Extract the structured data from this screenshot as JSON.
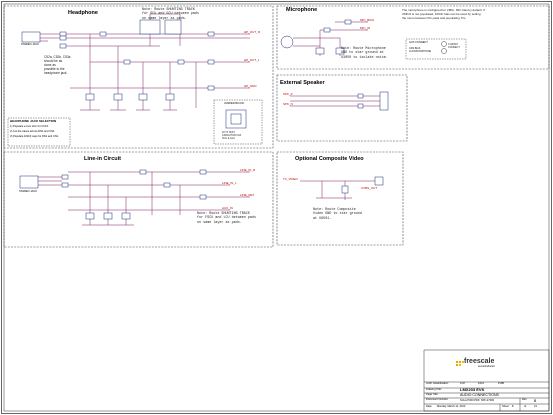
{
  "sections": {
    "headphone": {
      "title": "Headphone",
      "note": "Note: Route SHUNTING TRACK\nfor SCU and GCU between pads\non same layer as pads.",
      "side_note": "C52a, C52b, C53a\nshould be as\nclose as\npossible to the\nheadphone jack.",
      "connector_label": "STEREO JACK",
      "jumper_label": "JUMPER BLOCK",
      "key_title": "HEADPHONE JACK SELECTION",
      "key_lines": [
        "1) Populate a zero ohm for CC16.",
        "2) Cut the traces across DN1 and CN1.",
        "3) Populate 100nF caps for DN1 and CN1."
      ],
      "cap_label": "40 T3 TEST\nCAPACITOR CLR\nSCU & GLU"
    },
    "microphone": {
      "title": "Microphone",
      "note": "Note: Route Microphone\nGND to star ground at\nU3050 to isolate noise.",
      "top_note": "The microphone is configured for VMIC. MIC bias by default. If\nVMIC2 is not populated, 100nF bias can be used by setting\nthe mono between Pin pads and populating Tim.",
      "legend_1": "AUX CONNECT",
      "legend_2": "ASM BIAS\nAUX/MICROPHONE",
      "legend_3": "C-MONO\nCONNECT"
    },
    "external_speaker": {
      "title": "External Speaker"
    },
    "line_in": {
      "title": "Line-in Circuit",
      "note": "Note: Route SHUNTING TRACE\nfor FSCU and LCU between pads\non same layer as pads.",
      "connector_label": "STEREO JACK"
    },
    "composite_video": {
      "title": "Optional Composite Video",
      "note": "Note: Route Composite\nVideo GND to star ground\nat U9501.",
      "net_in": "TV_VIDEO",
      "net_out": "CVBS_OUT"
    }
  },
  "nets": {
    "hp_right": "HP_OUT_R",
    "hp_left": "HP_OUT_L",
    "hp_gnd": "HP_GND",
    "mic_in": "MIC_IN",
    "mic_bias": "MIC_BIAS",
    "spk_p": "SPK_P",
    "spk_n": "SPK_N",
    "line_r": "LINE_IN_R",
    "line_l": "LINE_IN_L",
    "line_det": "LINE_DET",
    "aux": "AUX_IN"
  },
  "title_block": {
    "company": "freescale",
    "company_sub": "semiconductor",
    "board": "LMX233 EVK",
    "page_title_label": "Page Title:",
    "page_title": "AUDIO CONNECTIONS",
    "doc_label": "Document Number",
    "doc_number": "SCH-27000 PDF: SPF-27000",
    "rev_label": "Rev",
    "rev": "B",
    "date_label": "Date:",
    "date": "Monday, March 11, 2013",
    "sheet_label": "Sheet",
    "sheet": "8",
    "of_label": "of",
    "of": "21",
    "classification_label": "ICAP Classification:",
    "class_fcp": "FCP",
    "class_fiuo": "FIUO",
    "class_pubi": "PUBI",
    "drawing_label": "Drawing Title:"
  },
  "colors": {
    "wire": "#7a1f5c",
    "net_label": "#c00000",
    "component": "#1a2a7a",
    "frame": "#000000"
  }
}
